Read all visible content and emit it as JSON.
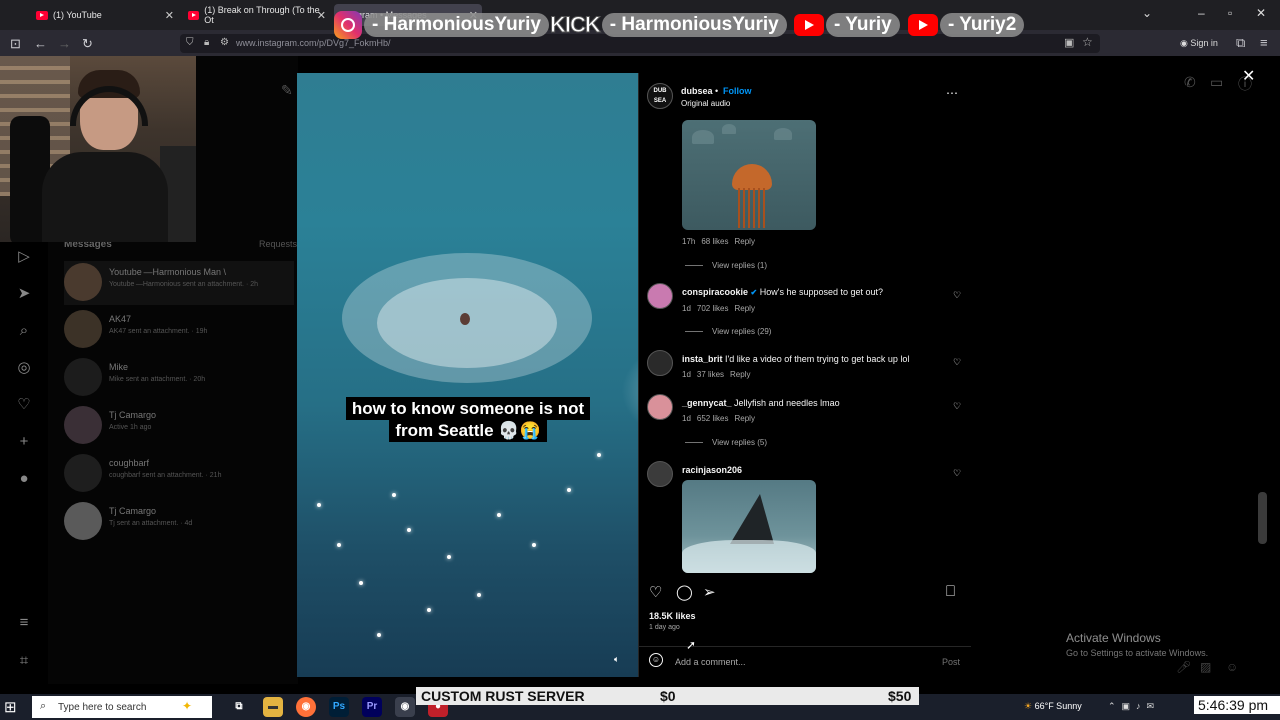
{
  "browser": {
    "tabs": [
      {
        "label": "(1) YouTube"
      },
      {
        "label": "(1) Break on Through (To the Ot"
      },
      {
        "label": "gram • Messages"
      }
    ],
    "url": "www.instagram.com/p/DVg7_FokmHb/",
    "sign_in": "Sign in"
  },
  "overlay": {
    "instagram": "- HarmoniousYuriy",
    "kick_logo": "KICK",
    "kick": "- HarmoniousYuriy",
    "youtube1": "- Yuriy",
    "youtube2": "- Yuriy2"
  },
  "messages_panel": {
    "title": "Messages",
    "requests": "Requests",
    "threads": [
      {
        "name": "Youtube —Harmonious Man \\",
        "sub": "Youtube —Harmonious sent an attachment. · 2h"
      },
      {
        "name": "AK47",
        "sub": "AK47 sent an attachment. · 19h"
      },
      {
        "name": "Mike",
        "sub": "Mike sent an attachment. · 20h"
      },
      {
        "name": "Tj Camargo",
        "sub": "Active 1h ago"
      },
      {
        "name": "coughbarf",
        "sub": "coughbarf sent an attachment. · 21h"
      },
      {
        "name": "Tj Camargo",
        "sub": "Tj sent an attachment. · 4d"
      }
    ]
  },
  "post": {
    "video_caption": "how to know someone is not from Seattle 💀😭",
    "author": "dubsea",
    "author_avatar_text": "DUB SEA",
    "follow": "Follow",
    "audio": "Original audio",
    "more": "⋯",
    "comments": [
      {
        "user": "",
        "text": "",
        "time": "17h",
        "likes": "68 likes",
        "reply": "Reply",
        "view_replies": "View replies (1)"
      },
      {
        "user": "conspiracookie",
        "text": "How's he supposed to get out?",
        "time": "1d",
        "likes": "702 likes",
        "reply": "Reply",
        "view_replies": "View replies (29)"
      },
      {
        "user": "insta_brit",
        "text": "I'd like a video of them trying to get back up lol",
        "time": "1d",
        "likes": "37 likes",
        "reply": "Reply"
      },
      {
        "user": "_gennycat_",
        "text": "Jellyfish and needles lmao",
        "time": "1d",
        "likes": "652 likes",
        "reply": "Reply",
        "view_replies": "View replies (5)"
      },
      {
        "user": "racinjason206",
        "text": ""
      }
    ],
    "likes_count": "18.5K likes",
    "posted": "1 day ago",
    "add_comment_placeholder": "Add a comment...",
    "post_button": "Post"
  },
  "windows_notice": {
    "line1": "Activate Windows",
    "line2": "Go to Settings to activate Windows."
  },
  "taskbar": {
    "search_placeholder": "Type here to search",
    "weather": "66°F  Sunny",
    "clock": "5:46:39 pm"
  },
  "rust_banner": {
    "title": "CUSTOM RUST SERVER",
    "current": "$0",
    "goal": "$50"
  }
}
